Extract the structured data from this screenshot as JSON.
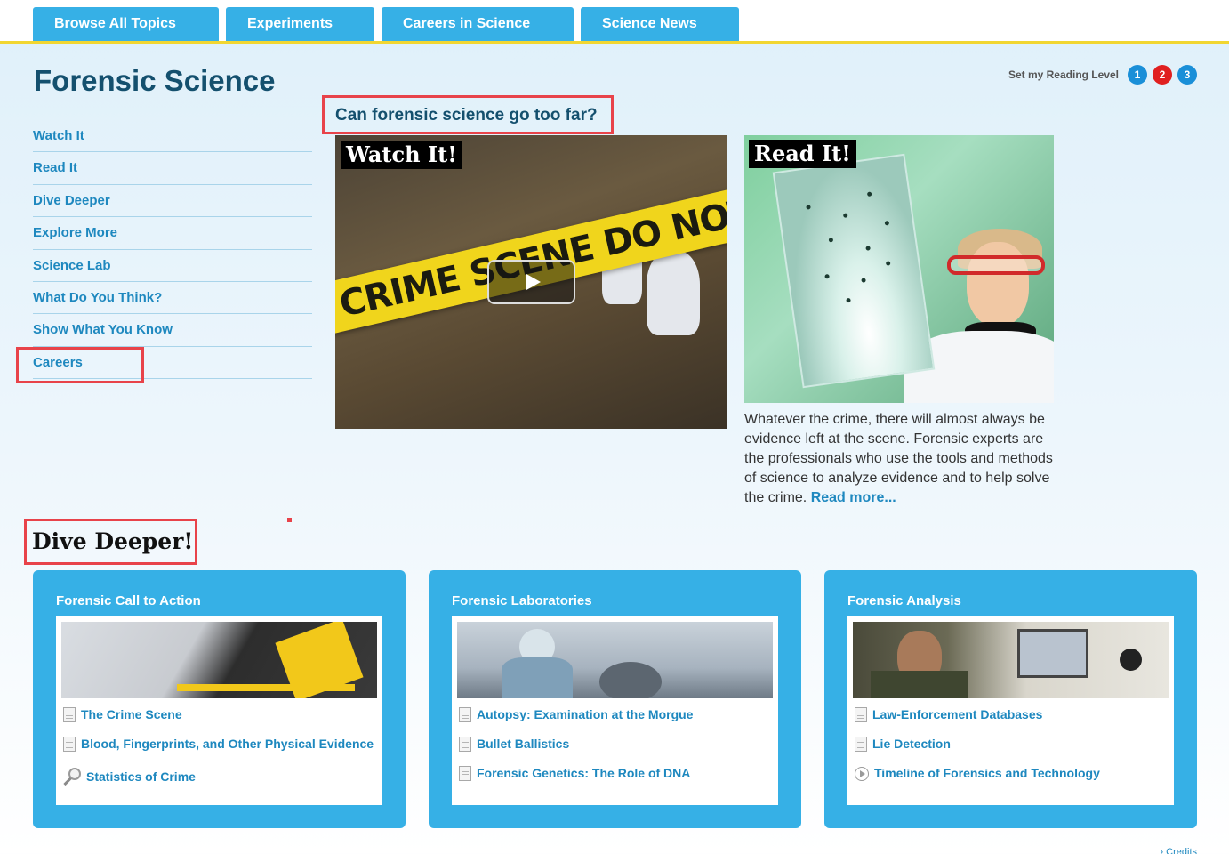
{
  "nav": {
    "tabs": [
      {
        "label": "Browse All Topics"
      },
      {
        "label": "Experiments"
      },
      {
        "label": "Careers in Science"
      },
      {
        "label": "Science News"
      }
    ]
  },
  "page_title": "Forensic Science",
  "reading_level": {
    "label": "Set my Reading Level",
    "levels": [
      {
        "label": "1",
        "color": "#1a8fd8"
      },
      {
        "label": "2",
        "color": "#e02020"
      },
      {
        "label": "3",
        "color": "#1a8fd8"
      }
    ]
  },
  "sidebar": {
    "items": [
      {
        "label": "Watch It"
      },
      {
        "label": "Read It"
      },
      {
        "label": "Dive Deeper"
      },
      {
        "label": "Explore More"
      },
      {
        "label": "Science Lab"
      },
      {
        "label": "What Do You Think?"
      },
      {
        "label": "Show What You Know"
      },
      {
        "label": "Careers"
      }
    ]
  },
  "feature": {
    "question": "Can forensic science go too far?",
    "watch_badge": "Watch It!",
    "tape_text": "CRIME SCENE DO NOT ENTER",
    "read_badge": "Read It!",
    "description": "Whatever the crime, there will almost always be evidence left at the scene. Forensic experts are the professionals who use the tools and methods of science to analyze evidence and to help solve the crime.",
    "read_more": "Read more..."
  },
  "dive_deeper": {
    "title": "Dive Deeper!",
    "cards": [
      {
        "title": "Forensic Call to Action",
        "links": [
          {
            "label": "The Crime Scene",
            "icon": "document-icon"
          },
          {
            "label": "Blood, Fingerprints, and Other Physical Evidence",
            "icon": "document-icon"
          },
          {
            "label": "Statistics of Crime",
            "icon": "magnifier-icon"
          }
        ]
      },
      {
        "title": "Forensic Laboratories",
        "links": [
          {
            "label": "Autopsy: Examination at the Morgue",
            "icon": "document-icon"
          },
          {
            "label": "Bullet Ballistics",
            "icon": "document-icon"
          },
          {
            "label": "Forensic Genetics: The Role of DNA",
            "icon": "document-icon"
          }
        ]
      },
      {
        "title": "Forensic Analysis",
        "links": [
          {
            "label": "Law-Enforcement Databases",
            "icon": "document-icon"
          },
          {
            "label": "Lie Detection",
            "icon": "document-icon"
          },
          {
            "label": "Timeline of Forensics and Technology",
            "icon": "play-circle-icon"
          }
        ]
      }
    ]
  },
  "footer": {
    "credits": "› Credits"
  },
  "colors": {
    "accent": "#36b0e6",
    "title": "#14506e",
    "link": "#1e88bf",
    "highlight": "#e8434a",
    "nav_underline": "#f1d631"
  }
}
